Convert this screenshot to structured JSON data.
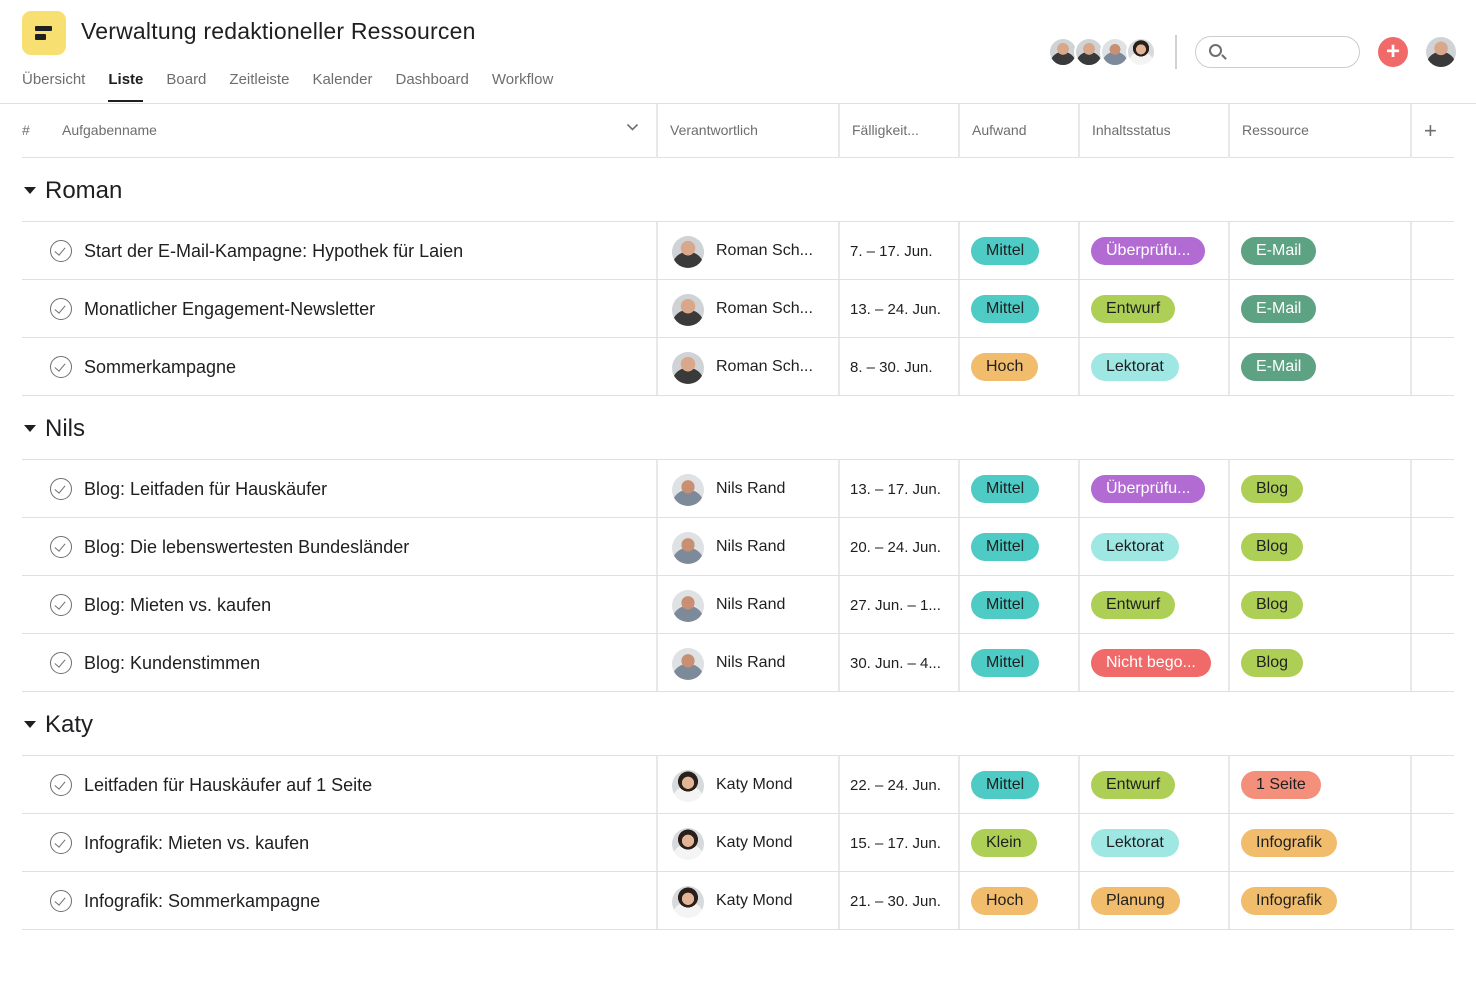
{
  "project": {
    "title": "Verwaltung redaktioneller Ressourcen",
    "icon": "project-list-icon",
    "accent_color": "#f8df72"
  },
  "tabs": [
    {
      "label": "Übersicht"
    },
    {
      "label": "Liste",
      "active": true
    },
    {
      "label": "Board"
    },
    {
      "label": "Zeitleiste"
    },
    {
      "label": "Kalender"
    },
    {
      "label": "Dashboard"
    },
    {
      "label": "Workflow"
    }
  ],
  "toolbar": {
    "members_icon": "member-avatars",
    "search_icon": "search-icon",
    "search_value": "",
    "add_icon": "plus-icon",
    "add_color": "#f06a6a",
    "profile_icon": "user-avatar"
  },
  "columns": {
    "number": "#",
    "task_name": "Aufgabenname",
    "assignee": "Verantwortlich",
    "due": "Fälligkeit...",
    "effort": "Aufwand",
    "status": "Inhaltsstatus",
    "resource": "Ressource",
    "add": "+"
  },
  "sections": [
    {
      "name": "Roman",
      "rows": [
        {
          "task": "Start der E-Mail-Kampagne: Hypothek für Laien",
          "assignee": "Roman Sch...",
          "due": "7. – 17. Jun.",
          "effort": "Mittel",
          "status": "Überprüfu...",
          "resource": "E-Mail"
        },
        {
          "task": "Monatlicher Engagement-Newsletter",
          "assignee": "Roman Sch...",
          "due": "13. – 24. Jun.",
          "effort": "Mittel",
          "status": "Entwurf",
          "resource": "E-Mail"
        },
        {
          "task": "Sommerkampagne",
          "assignee": "Roman Sch...",
          "due": "8. – 30. Jun.",
          "effort": "Hoch",
          "status": "Lektorat",
          "resource": "E-Mail"
        }
      ]
    },
    {
      "name": "Nils",
      "rows": [
        {
          "task": "Blog: Leitfaden für Hauskäufer",
          "assignee": "Nils Rand",
          "due": "13. – 17. Jun.",
          "effort": "Mittel",
          "status": "Überprüfu...",
          "resource": "Blog"
        },
        {
          "task": "Blog: Die lebenswertesten Bundesländer",
          "assignee": "Nils Rand",
          "due": "20. – 24. Jun.",
          "effort": "Mittel",
          "status": "Lektorat",
          "resource": "Blog"
        },
        {
          "task": "Blog: Mieten vs. kaufen",
          "assignee": "Nils Rand",
          "due": "27. Jun. – 1...",
          "effort": "Mittel",
          "status": "Entwurf",
          "resource": "Blog"
        },
        {
          "task": "Blog: Kundenstimmen",
          "assignee": "Nils Rand",
          "due": "30. Jun. – 4...",
          "effort": "Mittel",
          "status": "Nicht bego...",
          "resource": "Blog"
        }
      ]
    },
    {
      "name": "Katy",
      "rows": [
        {
          "task": "Leitfaden für Hauskäufer auf 1 Seite",
          "assignee": "Katy Mond",
          "due": "22. – 24. Jun.",
          "effort": "Mittel",
          "status": "Entwurf",
          "resource": "1 Seite"
        },
        {
          "task": "Infografik: Mieten vs. kaufen",
          "assignee": "Katy Mond",
          "due": "15. – 17. Jun.",
          "effort": "Klein",
          "status": "Lektorat",
          "resource": "Infografik"
        },
        {
          "task": "Infografik: Sommerkampagne",
          "assignee": "Katy Mond",
          "due": "21. – 30. Jun.",
          "effort": "Hoch",
          "status": "Planung",
          "resource": "Infografik"
        }
      ]
    }
  ],
  "pill_colors": {
    "Mittel": "#4ecbc4",
    "Hoch": "#f1bd6c",
    "Klein": "#aecf55",
    "Überprüfu...": "#b36bd4",
    "Entwurf": "#aecf55",
    "Lektorat": "#9ee7e3",
    "Nicht bego...": "#f06a6a",
    "Planung": "#f1bd6c",
    "E-Mail": "#5da283",
    "Blog": "#aecf55",
    "1 Seite": "#f38f7b",
    "Infografik": "#f1bd6c"
  }
}
